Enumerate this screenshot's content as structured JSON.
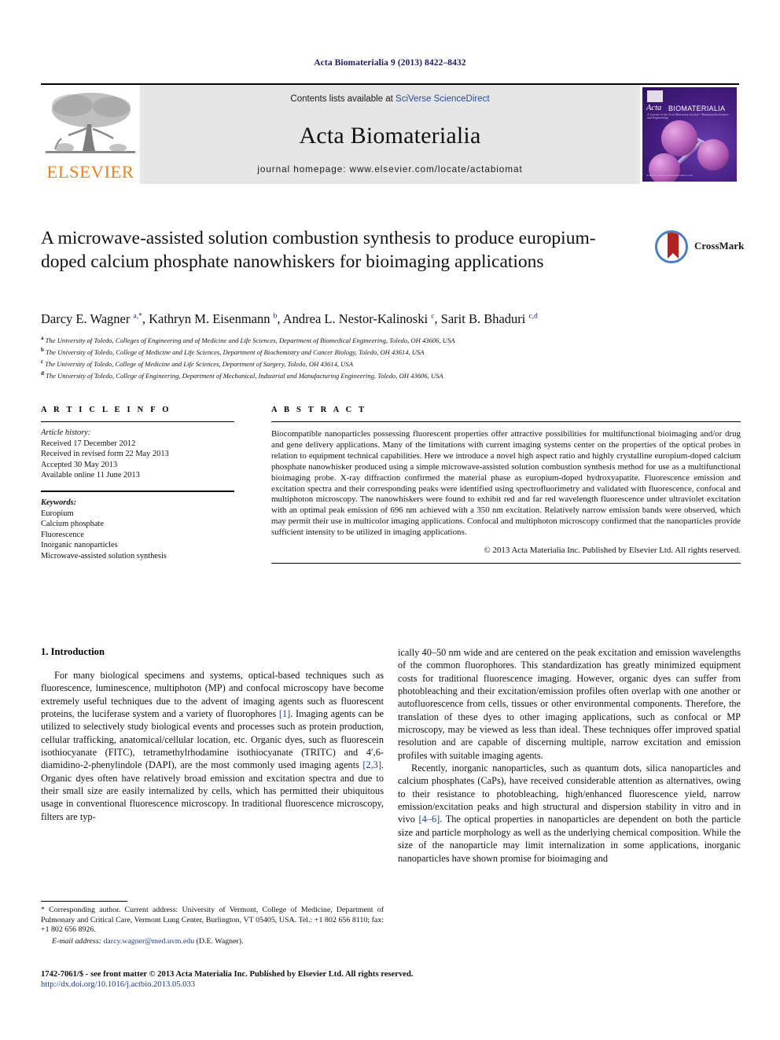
{
  "running_head": "Acta Biomaterialia 9 (2013) 8422–8432",
  "masthead": {
    "publisher_wordmark": "ELSEVIER",
    "contents_prefix": "Contents lists available at ",
    "contents_link": "SciVerse ScienceDirect",
    "journal_title": "Acta Biomaterialia",
    "homepage_line": "journal homepage: www.elsevier.com/locate/actabiomat",
    "cover": {
      "title_italic": "Acta",
      "title_caps": "BIOMATERIALIA",
      "subtitle": "A Journal of the Acta Materialia Society • Biomaterials Science and Engineering",
      "footer": "Available online at www.sciencedirect.com"
    }
  },
  "article": {
    "title": "A microwave-assisted solution combustion synthesis to produce europium-doped calcium phosphate nanowhiskers for bioimaging applications",
    "crossmark_label": "CrossMark",
    "authors_html": "Darcy E. Wagner <sup>a,*</sup>, Kathryn M. Eisenmann <sup>b</sup>, Andrea L. Nestor-Kalinoski <sup>c</sup>, Sarit B. Bhaduri <sup>c,d</sup>",
    "affiliations": [
      {
        "marker": "a",
        "text": "The University of Toledo, Colleges of Engineering and of Medicine and Life Sciences, Department of Biomedical Engineering, Toledo, OH 43606, USA"
      },
      {
        "marker": "b",
        "text": "The University of Toledo, College of Medicine and Life Sciences, Department of Biochemistry and Cancer Biology, Toledo, OH 43614, USA"
      },
      {
        "marker": "c",
        "text": "The University of Toledo, College of Medicine and Life Sciences, Department of Surgery, Toledo, OH 43614, USA"
      },
      {
        "marker": "d",
        "text": "The University of Toledo, College of Engineering, Department of Mechanical, Industrial and Manufacturing Engineering, Toledo, OH 43606, USA"
      }
    ]
  },
  "article_info": {
    "heading": "A R T I C L E    I N F O",
    "history_label": "Article history:",
    "history": [
      "Received 17 December 2012",
      "Received in revised form 22 May 2013",
      "Accepted 30 May 2013",
      "Available online 11 June 2013"
    ],
    "keywords_label": "Keywords:",
    "keywords": [
      "Europium",
      "Calcium phosphate",
      "Fluorescence",
      "Inorganic nanoparticles",
      "Microwave-assisted solution synthesis"
    ]
  },
  "abstract": {
    "heading": "A B S T R A C T",
    "text": "Biocompatible nanoparticles possessing fluorescent properties offer attractive possibilities for multifunctional bioimaging and/or drug and gene delivery applications. Many of the limitations with current imaging systems center on the properties of the optical probes in relation to equipment technical capabilities. Here we introduce a novel high aspect ratio and highly crystalline europium-doped calcium phosphate nanowhisker produced using a simple microwave-assisted solution combustion synthesis method for use as a multifunctional bioimaging probe. X-ray diffraction confirmed the material phase as europium-doped hydroxyapatite. Fluorescence emission and excitation spectra and their corresponding peaks were identified using spectrofluorimetry and validated with fluorescence, confocal and multiphoton microscopy. The nanowhiskers were found to exhibit red and far red wavelength fluorescence under ultraviolet excitation with an optimal peak emission of 696 nm achieved with a 350 nm excitation. Relatively narrow emission bands were observed, which may permit their use in multicolor imaging applications. Confocal and multiphoton microscopy confirmed that the nanoparticles provide sufficient intensity to be utilized in imaging applications.",
    "copyright": "© 2013 Acta Materialia Inc. Published by Elsevier Ltd. All rights reserved."
  },
  "introduction": {
    "heading": "1. Introduction",
    "left_paragraphs": [
      "For many biological specimens and systems, optical-based techniques such as fluorescence, luminescence, multiphoton (MP) and confocal microscopy have become extremely useful techniques due to the advent of imaging agents such as fluorescent proteins, the luciferase system and a variety of fluorophores [1]. Imaging agents can be utilized to selectively study biological events and processes such as protein production, cellular trafficking, anatomical/cellular location, etc. Organic dyes, such as fluorescein isothiocyanate (FITC), tetramethylrhodamine isothiocyanate (TRITC) and 4′,6-diamidino-2-phenylindole (DAPI), are the most commonly used imaging agents [2,3]. Organic dyes often have relatively broad emission and excitation spectra and due to their small size are easily internalized by cells, which has permitted their ubiquitous usage in conventional fluorescence microscopy. In traditional fluorescence microscopy, filters are typ-"
    ],
    "right_paragraphs": [
      "ically 40–50 nm wide and are centered on the peak excitation and emission wavelengths of the common fluorophores. This standardization has greatly minimized equipment costs for traditional fluorescence imaging. However, organic dyes can suffer from photobleaching and their excitation/emission profiles often overlap with one another or autofluorescence from cells, tissues or other environmental components. Therefore, the translation of these dyes to other imaging applications, such as confocal or MP microscopy, may be viewed as less than ideal. These techniques offer improved spatial resolution and are capable of discerning multiple, narrow excitation and emission profiles with suitable imaging agents.",
      "Recently, inorganic nanoparticles, such as quantum dots, silica nanoparticles and calcium phosphates (CaPs), have received considerable attention as alternatives, owing to their resistance to photobleaching, high/enhanced fluorescence yield, narrow emission/excitation peaks and high structural and dispersion stability in vitro and in vivo [4–6]. The optical properties in nanoparticles are dependent on both the particle size and particle morphology as well as the underlying chemical composition. While the size of the nanoparticle may limit internalization in some applications, inorganic nanoparticles have shown promise for bioimaging and"
    ]
  },
  "footnote": {
    "corresponding": "* Corresponding author. Current address: University of Vermont, College of Medicine, Department of Pulmonary and Critical Care, Vermont Lung Center, Burlington, VT 05405, USA. Tel.: +1 802 656 8110; fax: +1 802 656 8926.",
    "email_label": "E-mail address:",
    "email": "darcy.wagner@med.uvm.edu",
    "email_owner": "(D.E. Wagner)."
  },
  "bottom": {
    "issn_line": "1742-7061/$ - see front matter © 2013 Acta Materialia Inc. Published by Elsevier Ltd. All rights reserved.",
    "doi": "http://dx.doi.org/10.1016/j.actbio.2013.05.033"
  },
  "colors": {
    "runhead_navy": "#1b1b5e",
    "link_blue": "#1b3c8c",
    "elsevier_orange": "#f08020",
    "masthead_gray": "#e6e6e6",
    "crossmark_red": "#b22222",
    "crossmark_blue": "#4a7fbe"
  }
}
